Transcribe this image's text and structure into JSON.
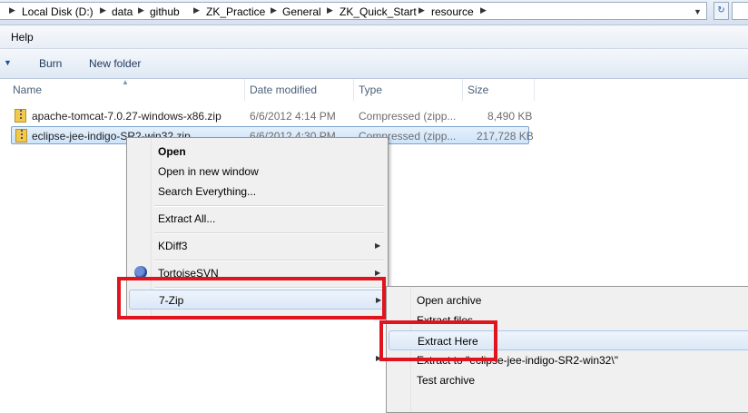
{
  "address_bar": {
    "crumbs": [
      "Local Disk (D:)",
      "data",
      "github",
      "ZK_Practice",
      "General",
      "ZK_Quick_Start",
      "resource"
    ]
  },
  "menu_bar": {
    "help_label": "Help"
  },
  "toolbar": {
    "burn_label": "Burn",
    "new_folder_label": "New folder"
  },
  "columns": {
    "name": "Name",
    "date_modified": "Date modified",
    "type": "Type",
    "size": "Size"
  },
  "files": [
    {
      "name": "apache-tomcat-7.0.27-windows-x86.zip",
      "date": "6/6/2012 4:14 PM",
      "type": "Compressed (zipp...",
      "size": "8,490 KB",
      "selected": false,
      "icon": "zip-folder-icon"
    },
    {
      "name": "eclipse-jee-indigo-SR2-win32.zip",
      "date": "6/6/2012 4:30 PM",
      "type": "Compressed (zipp...",
      "size": "217,728 KB",
      "selected": true,
      "icon": "zip-folder-icon"
    }
  ],
  "context_menu": {
    "open": "Open",
    "open_new_window": "Open in new window",
    "search_everything": "Search Everything...",
    "extract_all": "Extract All...",
    "kdiff3": "KDiff3",
    "tortoisesvn": "TortoiseSVN",
    "seven_zip": "7-Zip",
    "hovered": "7-Zip"
  },
  "seven_zip_submenu": {
    "open_archive": "Open archive",
    "extract_files": "Extract files...",
    "extract_here": "Extract Here",
    "extract_to": "Extract to \"eclipse-jee-indigo-SR2-win32\\\"",
    "test_archive": "Test archive",
    "hovered": "Extract Here"
  },
  "highlight_color": "#e0141e",
  "selection_color": "#cde4fa"
}
